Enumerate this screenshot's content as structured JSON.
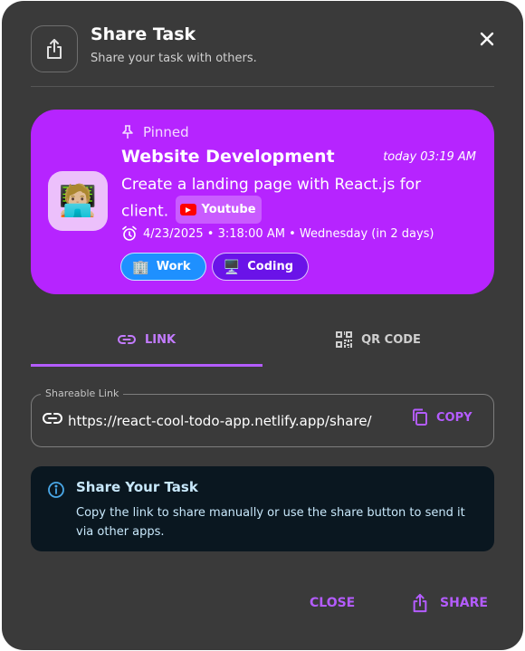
{
  "dialog": {
    "title": "Share Task",
    "subtitle": "Share your task with others."
  },
  "task": {
    "pinned_label": "Pinned",
    "title": "Website Development",
    "time": "today 03:19 AM",
    "description": "Create a landing page with React.js for client.",
    "link_chip": "Youtube",
    "deadline": "4/23/2025 • 3:18:00 AM • Wednesday (in 2 days)",
    "avatar_emoji": "🧑🏼‍💻",
    "categories": [
      {
        "emoji": "🏢",
        "label": "Work"
      },
      {
        "emoji": "🖥️",
        "label": "Coding"
      }
    ],
    "color": "#b624ff"
  },
  "tabs": [
    {
      "label": "LINK",
      "icon": "link-icon",
      "active": true
    },
    {
      "label": "QR CODE",
      "icon": "qr-code-icon",
      "active": false
    }
  ],
  "share_link": {
    "label": "Shareable Link",
    "value": "https://react-cool-todo-app.netlify.app/share/",
    "copy_label": "COPY"
  },
  "info": {
    "title": "Share Your Task",
    "text": "Copy the link to share manually or use the share button to send it via other apps."
  },
  "actions": {
    "close_label": "CLOSE",
    "share_label": "SHARE"
  },
  "colors": {
    "accent": "#b45cff",
    "dialog_bg": "#3a3a3a",
    "info_bg": "#0a1720"
  }
}
